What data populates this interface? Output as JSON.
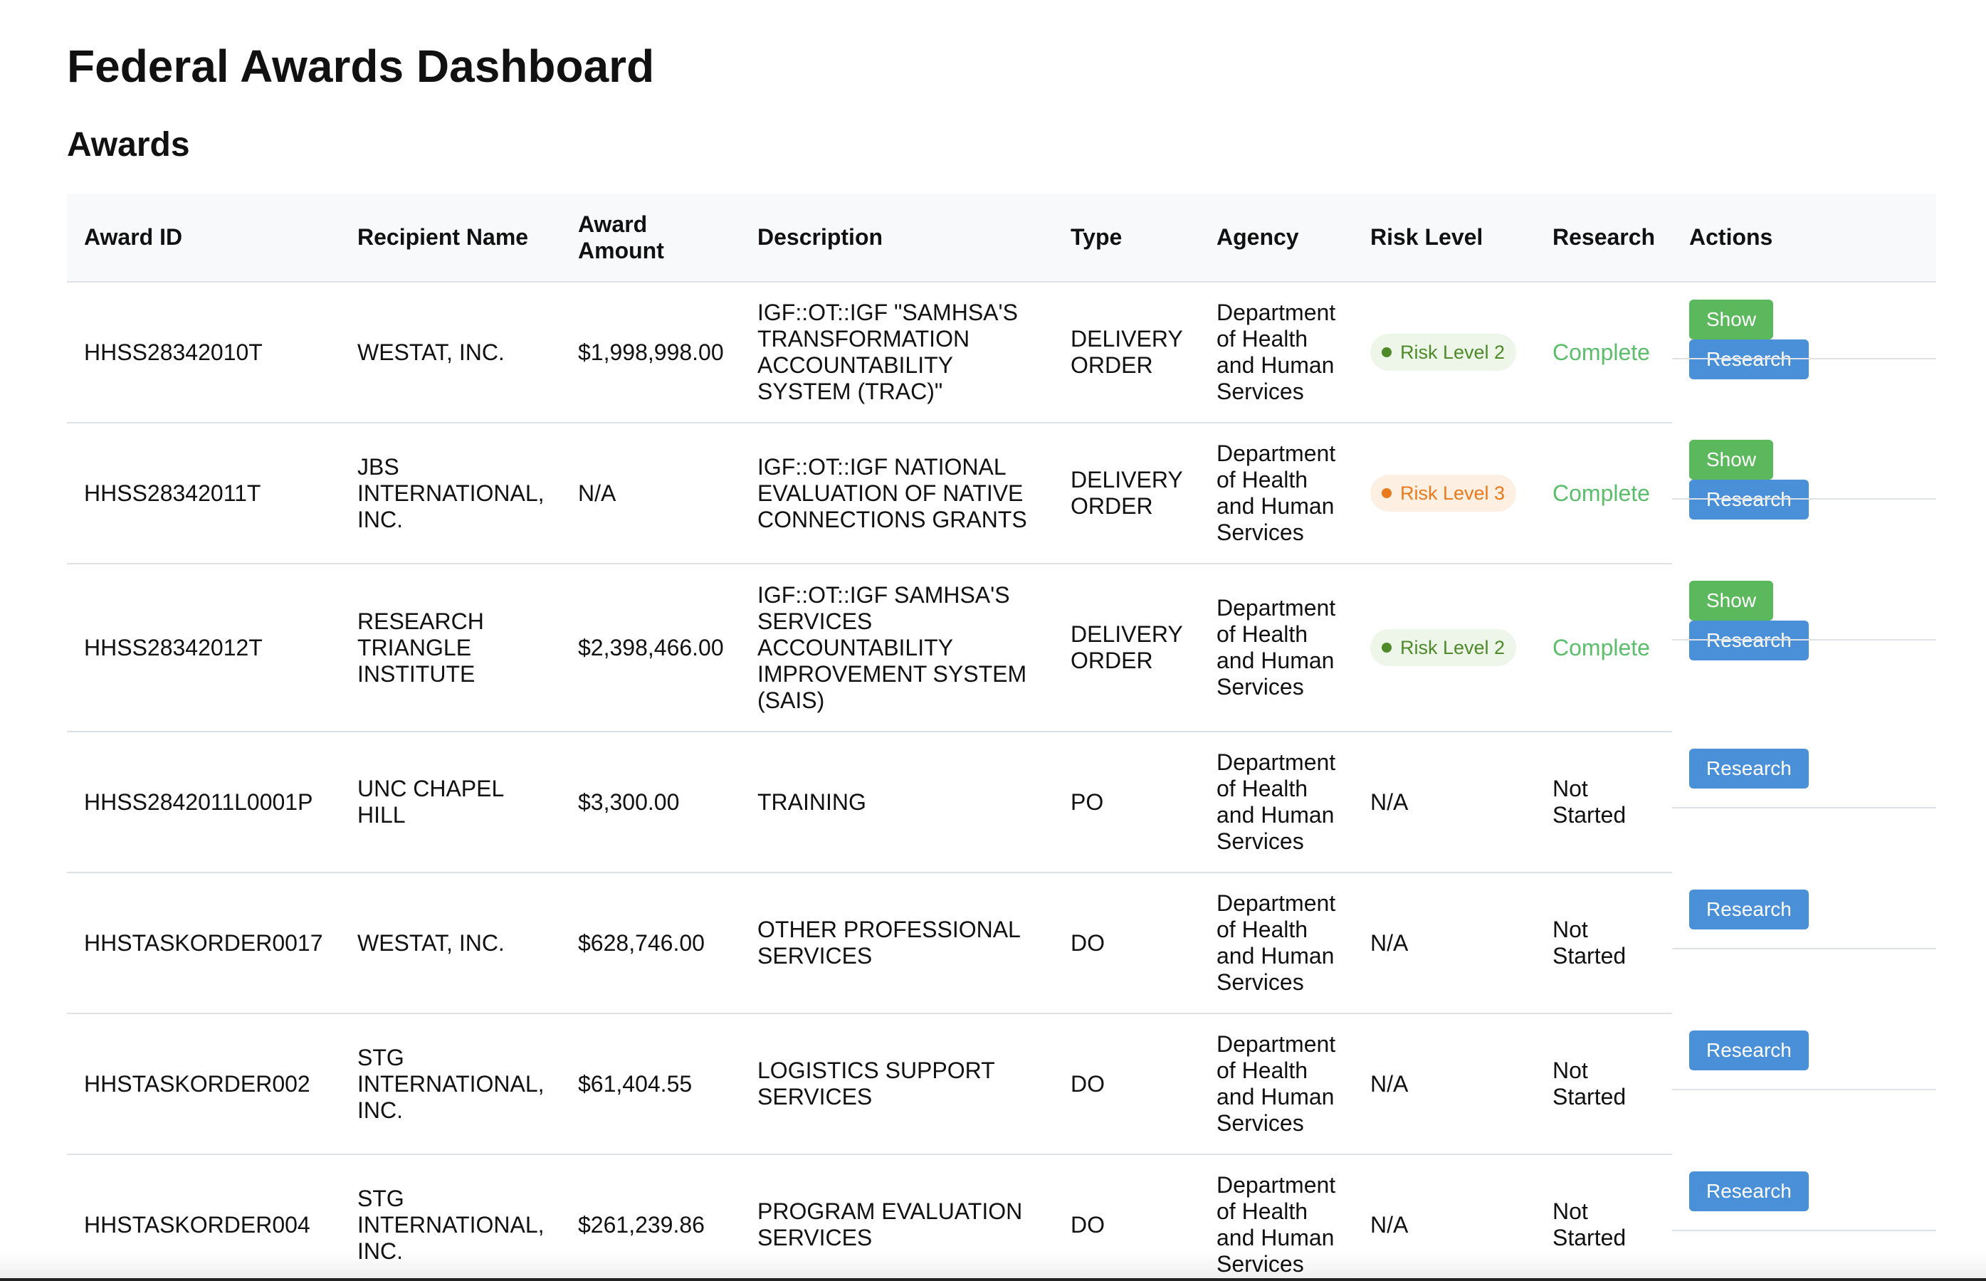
{
  "page": {
    "title": "Federal Awards Dashboard",
    "section_title": "Awards"
  },
  "table": {
    "headers": [
      "Award ID",
      "Recipient Name",
      "Award Amount",
      "Description",
      "Type",
      "Agency",
      "Risk Level",
      "Research",
      "Actions"
    ],
    "rows": [
      {
        "award_id": "HHSS28342010T",
        "recipient": "WESTAT, INC.",
        "amount": "$1,998,998.00",
        "description": "IGF::OT::IGF \"SAMHSA'S TRANSFORMATION ACCOUNTABILITY SYSTEM (TRAC)\"",
        "type": "DELIVERY ORDER",
        "agency": "Department of Health and Human Services",
        "risk": "Risk Level 2",
        "research": "Complete",
        "show_label": "Show",
        "research_label": "Research"
      },
      {
        "award_id": "HHSS28342011T",
        "recipient": "JBS INTERNATIONAL, INC.",
        "amount": "N/A",
        "description": "IGF::OT::IGF NATIONAL EVALUATION OF NATIVE CONNECTIONS GRANTS",
        "type": "DELIVERY ORDER",
        "agency": "Department of Health and Human Services",
        "risk": "Risk Level 3",
        "research": "Complete",
        "show_label": "Show",
        "research_label": "Research"
      },
      {
        "award_id": "HHSS28342012T",
        "recipient": "RESEARCH TRIANGLE INSTITUTE",
        "amount": "$2,398,466.00",
        "description": "IGF::OT::IGF SAMHSA'S SERVICES ACCOUNTABILITY IMPROVEMENT SYSTEM (SAIS)",
        "type": "DELIVERY ORDER",
        "agency": "Department of Health and Human Services",
        "risk": "Risk Level 2",
        "research": "Complete",
        "show_label": "Show",
        "research_label": "Research"
      },
      {
        "award_id": "HHSS2842011L0001P",
        "recipient": "UNC CHAPEL HILL",
        "amount": "$3,300.00",
        "description": "TRAINING",
        "type": "PO",
        "agency": "Department of Health and Human Services",
        "risk": "N/A",
        "research": "Not Started",
        "research_label": "Research"
      },
      {
        "award_id": "HHSTASKORDER0017",
        "recipient": "WESTAT, INC.",
        "amount": "$628,746.00",
        "description": "OTHER PROFESSIONAL SERVICES",
        "type": "DO",
        "agency": "Department of Health and Human Services",
        "risk": "N/A",
        "research": "Not Started",
        "research_label": "Research"
      },
      {
        "award_id": "HHSTASKORDER002",
        "recipient": "STG INTERNATIONAL, INC.",
        "amount": "$61,404.55",
        "description": "LOGISTICS SUPPORT SERVICES",
        "type": "DO",
        "agency": "Department of Health and Human Services",
        "risk": "N/A",
        "research": "Not Started",
        "research_label": "Research"
      },
      {
        "award_id": "HHSTASKORDER004",
        "recipient": "STG INTERNATIONAL, INC.",
        "amount": "$261,239.86",
        "description": "PROGRAM EVALUATION SERVICES",
        "type": "DO",
        "agency": "Department of Health and Human Services",
        "risk": "N/A",
        "research": "Not Started",
        "research_label": "Research"
      }
    ]
  },
  "colors": {
    "show_button": "#5cb85c",
    "research_button": "#4a90d9",
    "complete_text": "#5cbe6c",
    "risk_level_2": "#4e8a2a",
    "risk_level_3": "#e8791c",
    "header_bg": "#f8f9fa"
  }
}
